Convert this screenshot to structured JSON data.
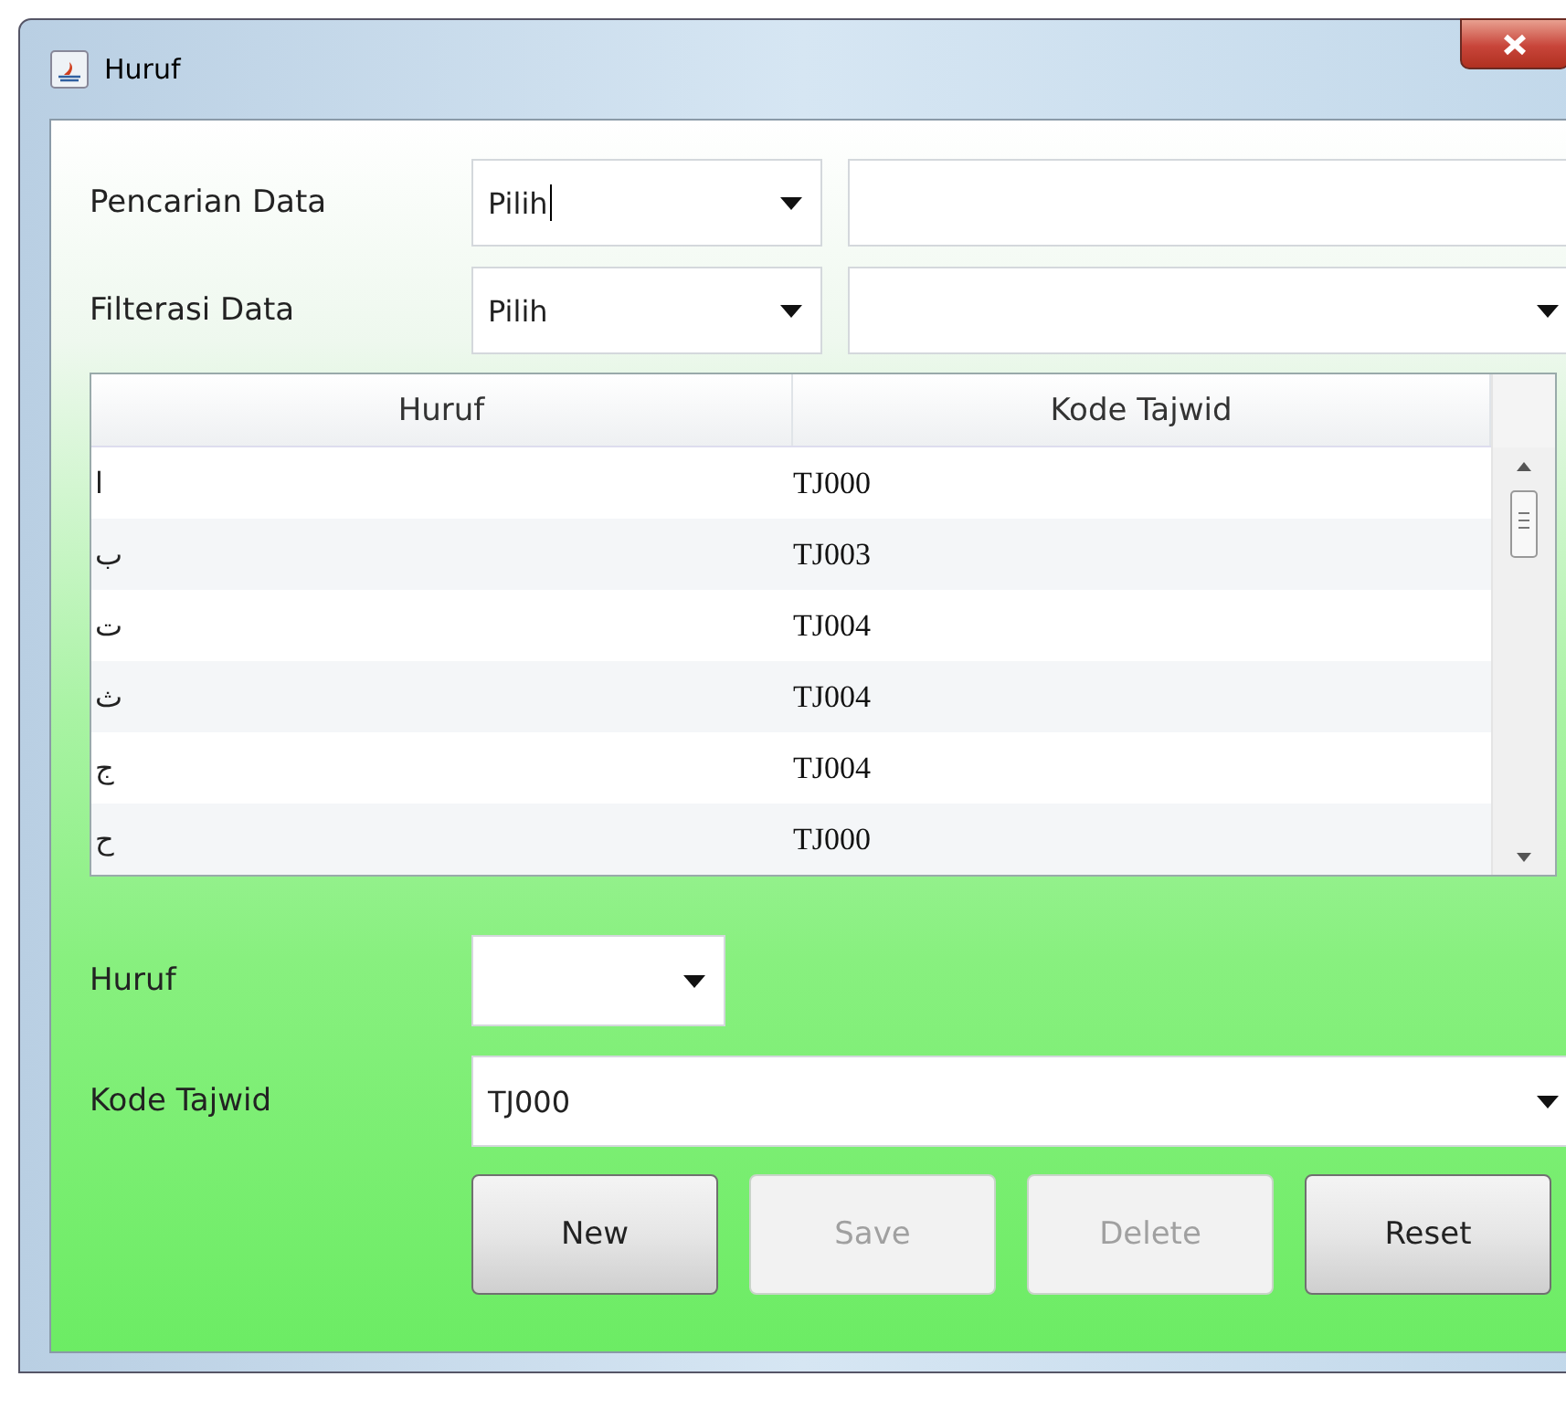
{
  "window": {
    "title": "Huruf"
  },
  "search": {
    "label": "Pencarian Data",
    "combo": {
      "value": "Pilih",
      "focused": true
    }
  },
  "filter": {
    "label": "Filterasi Data",
    "combo": {
      "value": "Pilih",
      "focused": false
    }
  },
  "table": {
    "columns": [
      "Huruf",
      "Kode Tajwid"
    ],
    "rows": [
      {
        "huruf": "ا",
        "kode": "TJ000"
      },
      {
        "huruf": "ب",
        "kode": "TJ003"
      },
      {
        "huruf": "ت",
        "kode": "TJ004"
      },
      {
        "huruf": "ث",
        "kode": "TJ004"
      },
      {
        "huruf": "ج",
        "kode": "TJ004"
      },
      {
        "huruf": "ح",
        "kode": "TJ000"
      }
    ]
  },
  "form": {
    "huruf_label": "Huruf",
    "kode_label": "Kode Tajwid",
    "kode_value": "TJ000"
  },
  "buttons": [
    {
      "label": "New",
      "disabled": false
    },
    {
      "label": "Save",
      "disabled": true
    },
    {
      "label": "Delete",
      "disabled": true
    },
    {
      "label": "Reset",
      "disabled": false
    }
  ]
}
